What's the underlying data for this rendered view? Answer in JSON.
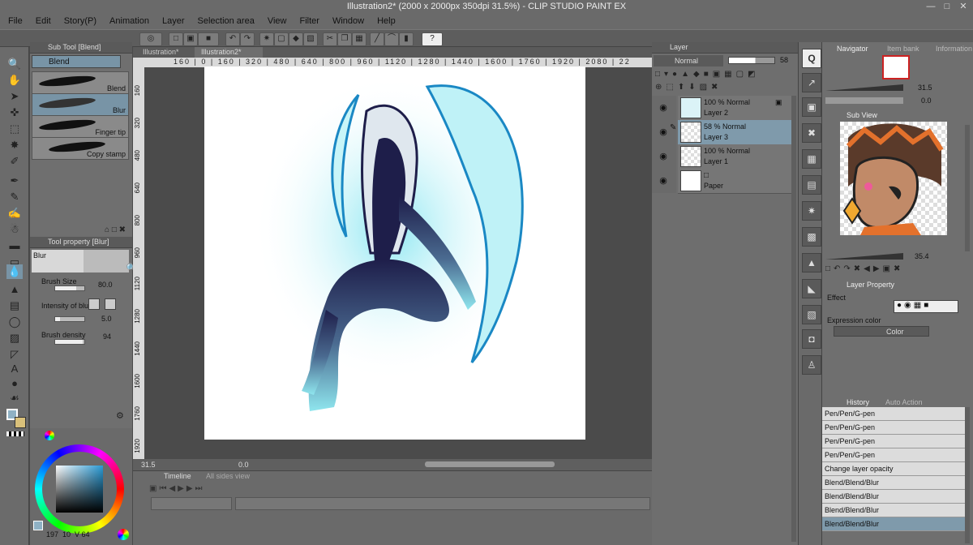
{
  "titlebar": {
    "title": "Illustration2* (2000 x 2000px 350dpi 31.5%) - CLIP STUDIO PAINT EX"
  },
  "menu": [
    "File",
    "Edit",
    "Story(P)",
    "Animation",
    "Layer",
    "Selection area",
    "View",
    "Filter",
    "Window",
    "Help"
  ],
  "doc_tabs": [
    "Illustration*",
    "Illustration2*"
  ],
  "ruler_marks": "160 | 0 | 160 | 320 | 480 | 640 | 800 | 960 | 1120 | 1280 | 1440 | 1600 | 1760 | 1920 | 2080 | 22",
  "vruler_marks": [
    "160",
    "320",
    "480",
    "640",
    "800",
    "960",
    "1120",
    "1280",
    "1440",
    "1600",
    "1760",
    "1920"
  ],
  "subtool": {
    "title": "Sub Tool [Blend]",
    "group": "Blend",
    "items": [
      "Blend",
      "Blur",
      "Finger tip",
      "Copy stamp"
    ],
    "selected": "Blur"
  },
  "toolprop": {
    "title": "Tool property [Blur]",
    "name": "Blur",
    "brush_size_label": "Brush Size",
    "brush_size_value": "80.0",
    "intensity_label": "Intensity of blur",
    "intensity_value": "5.0",
    "density_label": "Brush density",
    "density_value": "94"
  },
  "color": {
    "values": "197  10  V 64",
    "main": "#8fb1c4",
    "sub": "#d9c07a"
  },
  "layer": {
    "panel_title": "Layer",
    "blend_mode": "Normal",
    "opacity": "58",
    "layers": [
      {
        "mode": "100 % Normal",
        "name": "Layer 2"
      },
      {
        "mode": "58 % Normal",
        "name": "Layer 3"
      },
      {
        "mode": "100 % Normal",
        "name": "Layer 1"
      },
      {
        "mode": "",
        "name": "Paper"
      }
    ],
    "selected_index": 1
  },
  "status": {
    "zoom": "31.5",
    "angle": "0.0"
  },
  "timeline": {
    "title": "Timeline",
    "tab2": "All sides view"
  },
  "navigator": {
    "tabs": [
      "Navigator",
      "Item bank",
      "Information"
    ],
    "zoom": "31.5",
    "angle": "0.0"
  },
  "subview": {
    "title": "Sub View",
    "zoom": "35.4"
  },
  "layerprop": {
    "title": "Layer Property",
    "effect_label": "Effect",
    "expression_label": "Expression color",
    "expression_value": "Color"
  },
  "history": {
    "tabs": [
      "History",
      "Auto Action"
    ],
    "items": [
      "Pen/Pen/G-pen",
      "Pen/Pen/G-pen",
      "Pen/Pen/G-pen",
      "Pen/Pen/G-pen",
      "Change layer opacity",
      "Blend/Blend/Blur",
      "Blend/Blend/Blur",
      "Blend/Blend/Blur",
      "Blend/Blend/Blur"
    ],
    "selected_index": 8
  }
}
